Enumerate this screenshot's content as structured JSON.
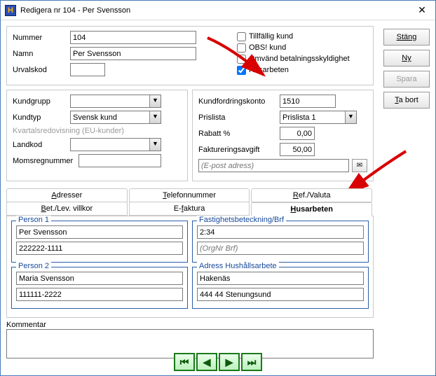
{
  "window": {
    "title": "Redigera nr 104 - Per Svensson"
  },
  "side": {
    "close": "Stäng",
    "new": "Ny",
    "save": "Spara",
    "delete": "Ta bort"
  },
  "top": {
    "nummer_label": "Nummer",
    "nummer": "104",
    "namn_label": "Namn",
    "namn": "Per Svensson",
    "urvalskod_label": "Urvalskod",
    "urvalskod": "",
    "chk_tillfallig": "Tillfällig kund",
    "chk_obs": "OBS! kund",
    "chk_omvand": "Omvänd betalningsskyldighet",
    "chk_husarbeten": "Husarbeten"
  },
  "left": {
    "kundgrupp_label": "Kundgrupp",
    "kundgrupp": "",
    "kundtyp_label": "Kundtyp",
    "kundtyp": "Svensk kund",
    "kvartal_label": "Kvartalsredovisning (EU-kunder)",
    "landkod_label": "Landkod",
    "landkod": "",
    "momsreg_label": "Momsregnummer",
    "momsreg": ""
  },
  "right": {
    "kundfordring_label": "Kundfordringskonto",
    "kundfordring": "1510",
    "prislista_label": "Prislista",
    "prislista": "Prislista 1",
    "rabatt_label": "Rabatt %",
    "rabatt": "0,00",
    "fakturering_label": "Faktureringsavgift",
    "fakturering": "50,00",
    "epost_placeholder": "(E-post adress)"
  },
  "tabs": {
    "adresser": "Adresser",
    "telefonnummer": "Telefonnummer",
    "refvaluta": "Ref./Valuta",
    "betlev": "Bet./Lev. villkor",
    "efaktura": "E-faktura",
    "husarbeten": "Husarbeten"
  },
  "husarbeten": {
    "person1_legend": "Person 1",
    "person1_name": "Per Svensson",
    "person1_pnr": "222222-1111",
    "person2_legend": "Person 2",
    "person2_name": "Maria Svensson",
    "person2_pnr": "111111-2222",
    "fastighet_legend": "Fastighetsbeteckning/Brf",
    "fastighet_val": "2:34",
    "fastighet_org_placeholder": "(OrgNr Brf)",
    "adress_legend": "Adress Hushållsarbete",
    "adress_1": "Hakenäs",
    "adress_2": "444 44 Stenungsund"
  },
  "kommentar_label": "Kommentar"
}
